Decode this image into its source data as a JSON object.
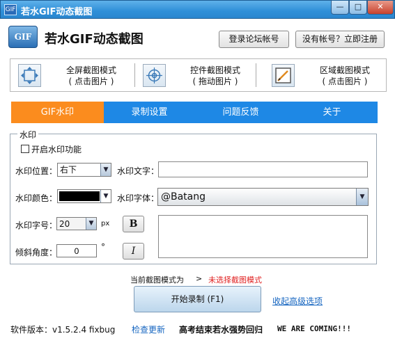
{
  "window": {
    "title": "若水GIF动态截图",
    "app_icon_text": "GIF",
    "min_label": "—",
    "max_label": "□",
    "close_label": "✕"
  },
  "header": {
    "logo_text": "GIF",
    "app_name": "若水GIF动态截图",
    "login_label": "登录论坛帐号",
    "register_label": "没有帐号？立即注册"
  },
  "modes": [
    {
      "title": "全屏截图模式",
      "hint": "( 点击图片 )",
      "icon": "fullscreen-icon"
    },
    {
      "title": "控件截图模式",
      "hint": "( 拖动图片 )",
      "icon": "crosshair-icon"
    },
    {
      "title": "区域截图模式",
      "hint": "( 点击图片 )",
      "icon": "region-icon"
    }
  ],
  "tabs": [
    "GIF水印",
    "录制设置",
    "问题反馈",
    "关于"
  ],
  "watermark": {
    "group_title": "水印",
    "enable_label": "开启水印功能",
    "position_label": "水印位置：",
    "position_value": "右下",
    "text_label": "水印文字：",
    "text_value": "",
    "color_label": "水印颜色：",
    "color_value": "#000000",
    "font_label": "水印字体：",
    "font_value": "@Batang",
    "size_label": "水印字号：",
    "size_value": "20",
    "size_unit": "px",
    "bold_label": "B",
    "italic_label": "I",
    "angle_label": "倾斜角度：",
    "angle_value": "0",
    "angle_unit": "°"
  },
  "status": {
    "current_mode_label": "当前截图模式为",
    "arrow": ">",
    "current_mode_value": "未选择截图模式"
  },
  "actions": {
    "start_label": "开始录制 (F1)",
    "collapse_label": "收起高级选项"
  },
  "footer": {
    "version": "软件版本：v1.5.2.4 fixbug",
    "check_update": "检查更新",
    "slogan": "高考结束若水强势回归",
    "coming": "WE ARE COMING!!!"
  }
}
